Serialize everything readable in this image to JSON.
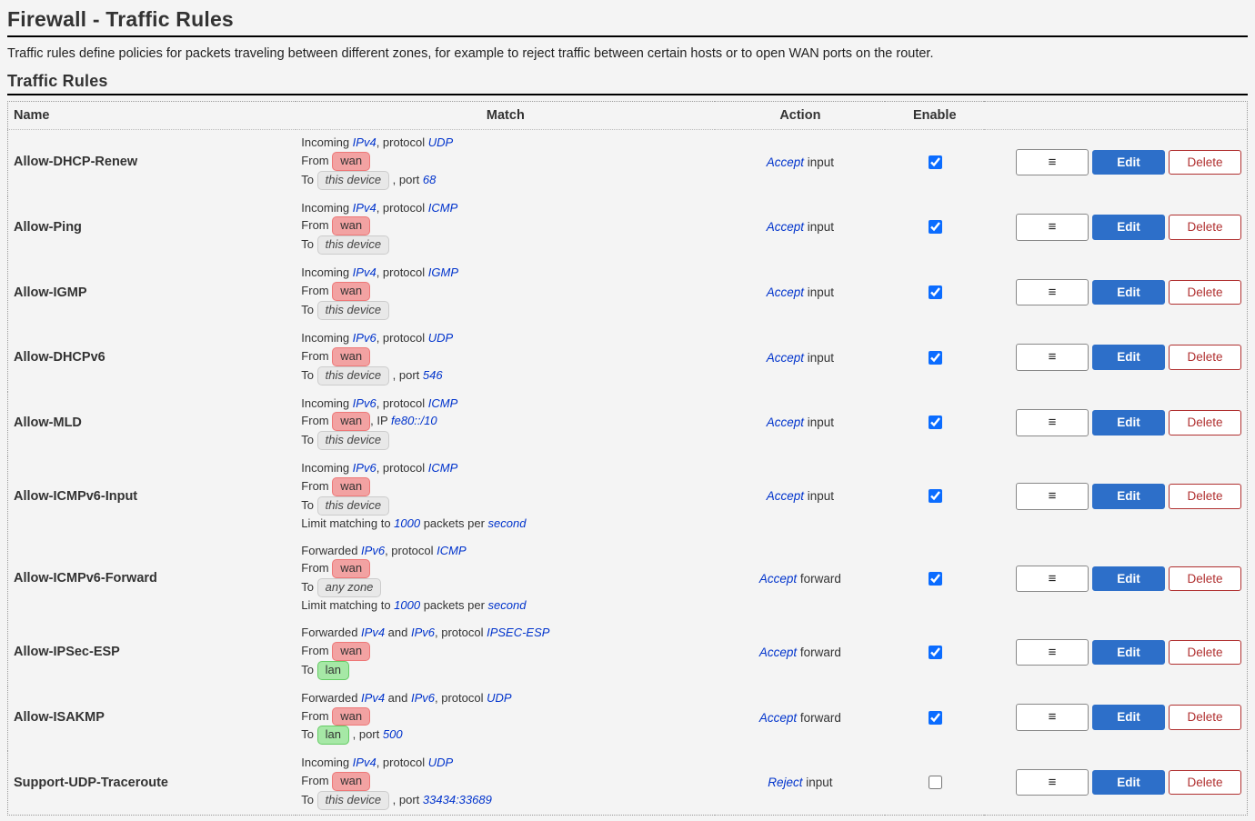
{
  "header": {
    "title": "Firewall - Traffic Rules",
    "description": "Traffic rules define policies for packets traveling between different zones, for example to reject traffic between certain hosts or to open WAN ports on the router."
  },
  "section": {
    "title": "Traffic Rules"
  },
  "columns": {
    "name": "Name",
    "match": "Match",
    "action": "Action",
    "enable": "Enable"
  },
  "words": {
    "incoming": "Incoming",
    "forwarded": "Forwarded",
    "protocol": ", protocol",
    "from": "From",
    "to": "To",
    "ip_label": ", IP",
    "port_label": ", port",
    "limit_prefix": "Limit matching to",
    "packets_per": "packets per",
    "and": "and",
    "input": "input",
    "forward": "forward"
  },
  "buttons": {
    "reorder_glyph": "≡",
    "edit": "Edit",
    "delete": "Delete"
  },
  "rules": [
    {
      "name": "Allow-DHCP-Renew",
      "direction": "incoming",
      "family": "IPv4",
      "protocol": "UDP",
      "from_zone": "wan",
      "to_zone": "this device",
      "to_port": "68",
      "action": "Accept",
      "action_suffix": "input",
      "enabled": true
    },
    {
      "name": "Allow-Ping",
      "direction": "incoming",
      "family": "IPv4",
      "protocol": "ICMP",
      "from_zone": "wan",
      "to_zone": "this device",
      "action": "Accept",
      "action_suffix": "input",
      "enabled": true
    },
    {
      "name": "Allow-IGMP",
      "direction": "incoming",
      "family": "IPv4",
      "protocol": "IGMP",
      "from_zone": "wan",
      "to_zone": "this device",
      "action": "Accept",
      "action_suffix": "input",
      "enabled": true
    },
    {
      "name": "Allow-DHCPv6",
      "direction": "incoming",
      "family": "IPv6",
      "protocol": "UDP",
      "from_zone": "wan",
      "to_zone": "this device",
      "to_port": "546",
      "action": "Accept",
      "action_suffix": "input",
      "enabled": true
    },
    {
      "name": "Allow-MLD",
      "direction": "incoming",
      "family": "IPv6",
      "protocol": "ICMP",
      "from_zone": "wan",
      "from_ip": "fe80::/10",
      "to_zone": "this device",
      "action": "Accept",
      "action_suffix": "input",
      "enabled": true
    },
    {
      "name": "Allow-ICMPv6-Input",
      "direction": "incoming",
      "family": "IPv6",
      "protocol": "ICMP",
      "from_zone": "wan",
      "to_zone": "this device",
      "limit_count": "1000",
      "limit_unit": "second",
      "action": "Accept",
      "action_suffix": "input",
      "enabled": true
    },
    {
      "name": "Allow-ICMPv6-Forward",
      "direction": "forwarded",
      "family": "IPv6",
      "protocol": "ICMP",
      "from_zone": "wan",
      "to_zone": "any zone",
      "limit_count": "1000",
      "limit_unit": "second",
      "action": "Accept",
      "action_suffix": "forward",
      "enabled": true
    },
    {
      "name": "Allow-IPSec-ESP",
      "direction": "forwarded",
      "family": "IPv4",
      "family2": "IPv6",
      "protocol": "IPSEC-ESP",
      "from_zone": "wan",
      "to_zone": "lan",
      "action": "Accept",
      "action_suffix": "forward",
      "enabled": true
    },
    {
      "name": "Allow-ISAKMP",
      "direction": "forwarded",
      "family": "IPv4",
      "family2": "IPv6",
      "protocol": "UDP",
      "from_zone": "wan",
      "to_zone": "lan",
      "to_port": "500",
      "action": "Accept",
      "action_suffix": "forward",
      "enabled": true
    },
    {
      "name": "Support-UDP-Traceroute",
      "direction": "incoming",
      "family": "IPv4",
      "protocol": "UDP",
      "from_zone": "wan",
      "to_zone": "this device",
      "to_port": "33434:33689",
      "action": "Reject",
      "action_suffix": "input",
      "enabled": false
    }
  ]
}
